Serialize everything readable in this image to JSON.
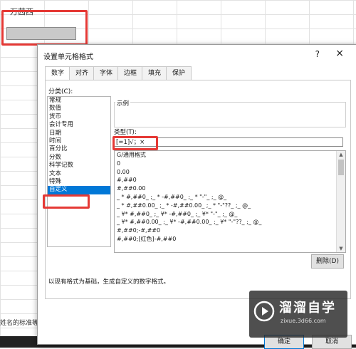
{
  "spreadsheet": {
    "cell_text": "万茜西",
    "status_text": "姓名的标准等"
  },
  "dialog": {
    "title": "设置单元格格式",
    "help": "?",
    "close": "×",
    "tabs": [
      "数字",
      "对齐",
      "字体",
      "边框",
      "填充",
      "保护"
    ],
    "category_label": "分类(C):",
    "categories": [
      "常规",
      "数值",
      "货币",
      "会计专用",
      "日期",
      "时间",
      "百分比",
      "分数",
      "科学记数",
      "文本",
      "特殊",
      "自定义"
    ],
    "selected_category": 11,
    "sample_label": "示例",
    "type_label": "类型(T):",
    "type_value": "[=1]√；×",
    "format_list": [
      "G/通用格式",
      "0",
      "0.00",
      "#,##0",
      "#,##0.00",
      "_ * #,##0_ ;_ * -#,##0_ ;_ * \"-\"_ ;_ @_",
      "_ * #,##0.00_ ;_ * -#,##0.00_ ;_ * \"-\"??_ ;_ @_",
      "_ ¥* #,##0_ ;_ ¥* -#,##0_ ;_ ¥* \"-\"_ ;_ @_",
      "_ ¥* #,##0.00_ ;_ ¥* -#,##0.00_ ;_ ¥* \"-\"??_ ;_ @_",
      "#,##0;-#,##0",
      "#,##0;[红色]-#,##0"
    ],
    "delete_button": "删除(D)",
    "description": "以现有格式为基础，生成自定义的数字格式。",
    "ok_button": "确定",
    "cancel_button": "取消"
  },
  "watermark": {
    "title": "溜溜自学",
    "url": "zixue.3d66.com"
  },
  "colors": {
    "highlight_red": "#e53935",
    "selection_blue": "#0078d7"
  }
}
